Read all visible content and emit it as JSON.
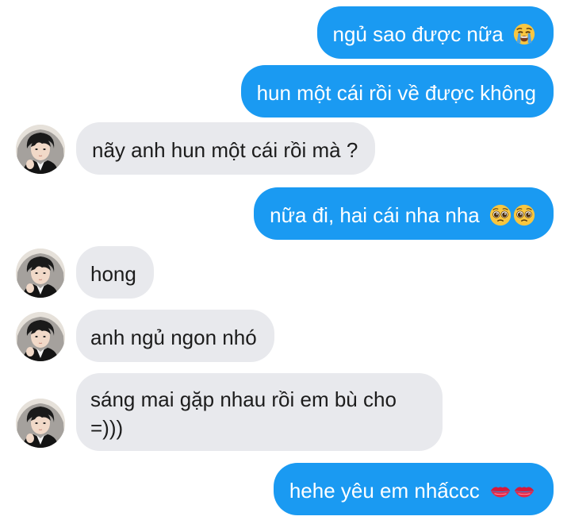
{
  "conversation": {
    "messages": [
      {
        "sender": "me",
        "text": "ngủ sao được nữa",
        "emoji": [
          "loudly-crying-face-icon"
        ]
      },
      {
        "sender": "me",
        "text": "hun một cái rồi về được không",
        "emoji": []
      },
      {
        "sender": "them",
        "text": "nãy anh hun một cái rồi mà ?",
        "emoji": []
      },
      {
        "sender": "me",
        "text": "nữa đi, hai cái nha nha",
        "emoji": [
          "pleading-face-icon",
          "pleading-face-icon"
        ]
      },
      {
        "sender": "them",
        "text": "hong",
        "emoji": []
      },
      {
        "sender": "them",
        "text": "anh ngủ ngon nhó",
        "emoji": []
      },
      {
        "sender": "them",
        "text": "sáng mai gặp nhau rồi em bù cho =)))",
        "emoji": []
      },
      {
        "sender": "me",
        "text": "hehe yêu em nhấccc",
        "emoji": [
          "kiss-mark-icon",
          "kiss-mark-icon"
        ]
      }
    ]
  },
  "colors": {
    "sent_bubble": "#1a9af2",
    "received_bubble": "#e8e9ed",
    "sent_text": "#ffffff",
    "received_text": "#1c1c1c"
  }
}
